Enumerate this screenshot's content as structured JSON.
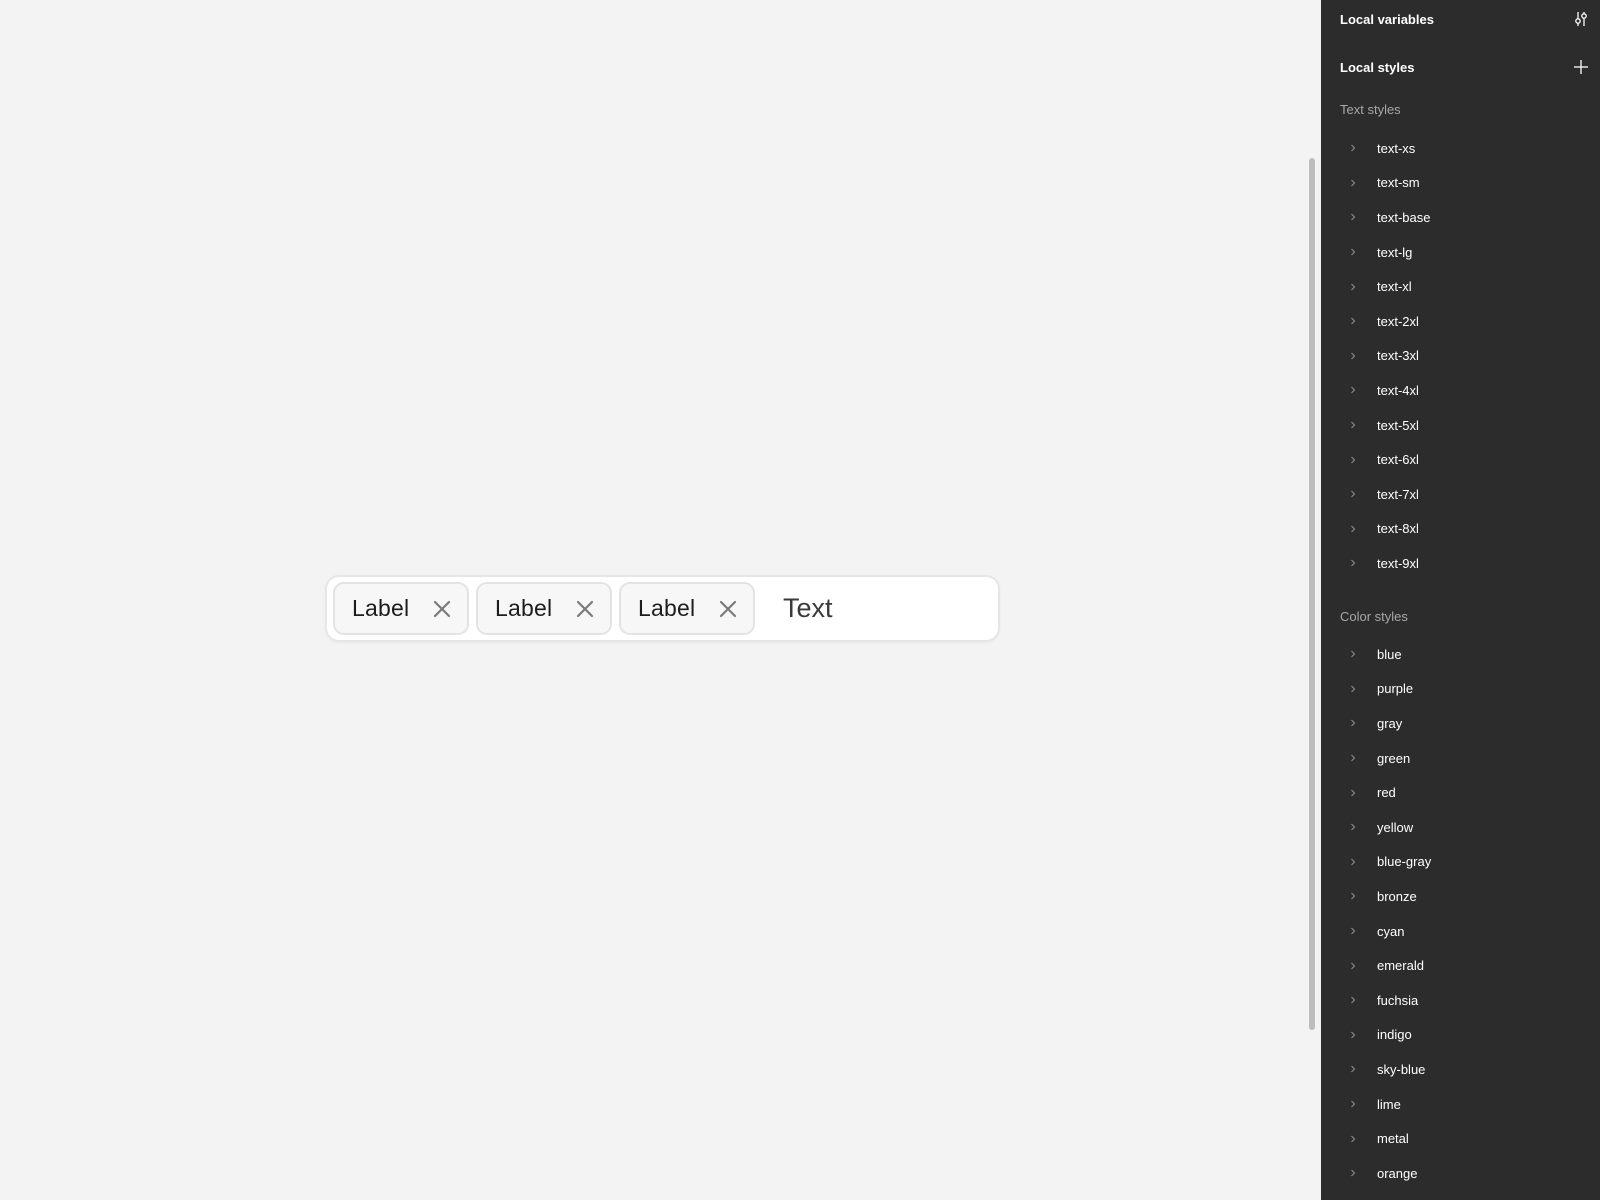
{
  "canvas": {
    "tag_input": {
      "chips": [
        {
          "label": "Label"
        },
        {
          "label": "Label"
        },
        {
          "label": "Label"
        }
      ],
      "text_placeholder": "Text"
    }
  },
  "panel": {
    "local_variables_title": "Local variables",
    "local_variables_icon": "adjust-sliders-icon",
    "local_styles_title": "Local styles",
    "local_styles_icon": "plus-icon",
    "text_styles": {
      "title": "Text styles",
      "items": [
        "text-xs",
        "text-sm",
        "text-base",
        "text-lg",
        "text-xl",
        "text-2xl",
        "text-3xl",
        "text-4xl",
        "text-5xl",
        "text-6xl",
        "text-7xl",
        "text-8xl",
        "text-9xl"
      ]
    },
    "color_styles": {
      "title": "Color styles",
      "items": [
        "blue",
        "purple",
        "gray",
        "green",
        "red",
        "yellow",
        "blue-gray",
        "bronze",
        "cyan",
        "emerald",
        "fuchsia",
        "indigo",
        "sky-blue",
        "lime",
        "metal",
        "orange"
      ]
    }
  },
  "colors": {
    "canvas_bg": "#f3f3f3",
    "panel_bg": "#2c2c2c",
    "panel_text": "#ffffff",
    "panel_muted": "#a8a8a8"
  }
}
